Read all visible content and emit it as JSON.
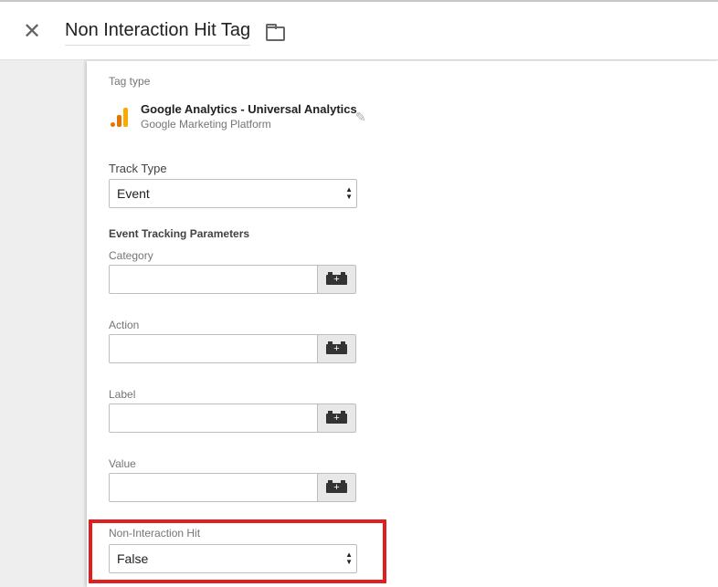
{
  "header": {
    "title": "Non Interaction Hit Tag"
  },
  "tag_type": {
    "label": "Tag type",
    "name": "Google Analytics - Universal Analytics",
    "platform": "Google Marketing Platform"
  },
  "track_type": {
    "label": "Track Type",
    "value": "Event"
  },
  "event_params": {
    "label": "Event Tracking Parameters",
    "fields": [
      {
        "label": "Category",
        "value": ""
      },
      {
        "label": "Action",
        "value": ""
      },
      {
        "label": "Label",
        "value": ""
      },
      {
        "label": "Value",
        "value": ""
      }
    ]
  },
  "non_interaction": {
    "label": "Non-Interaction Hit",
    "value": "False"
  },
  "colors": {
    "highlight": "#e02020",
    "ga_orange": "#f9ab00",
    "ga_dark": "#e37400"
  }
}
